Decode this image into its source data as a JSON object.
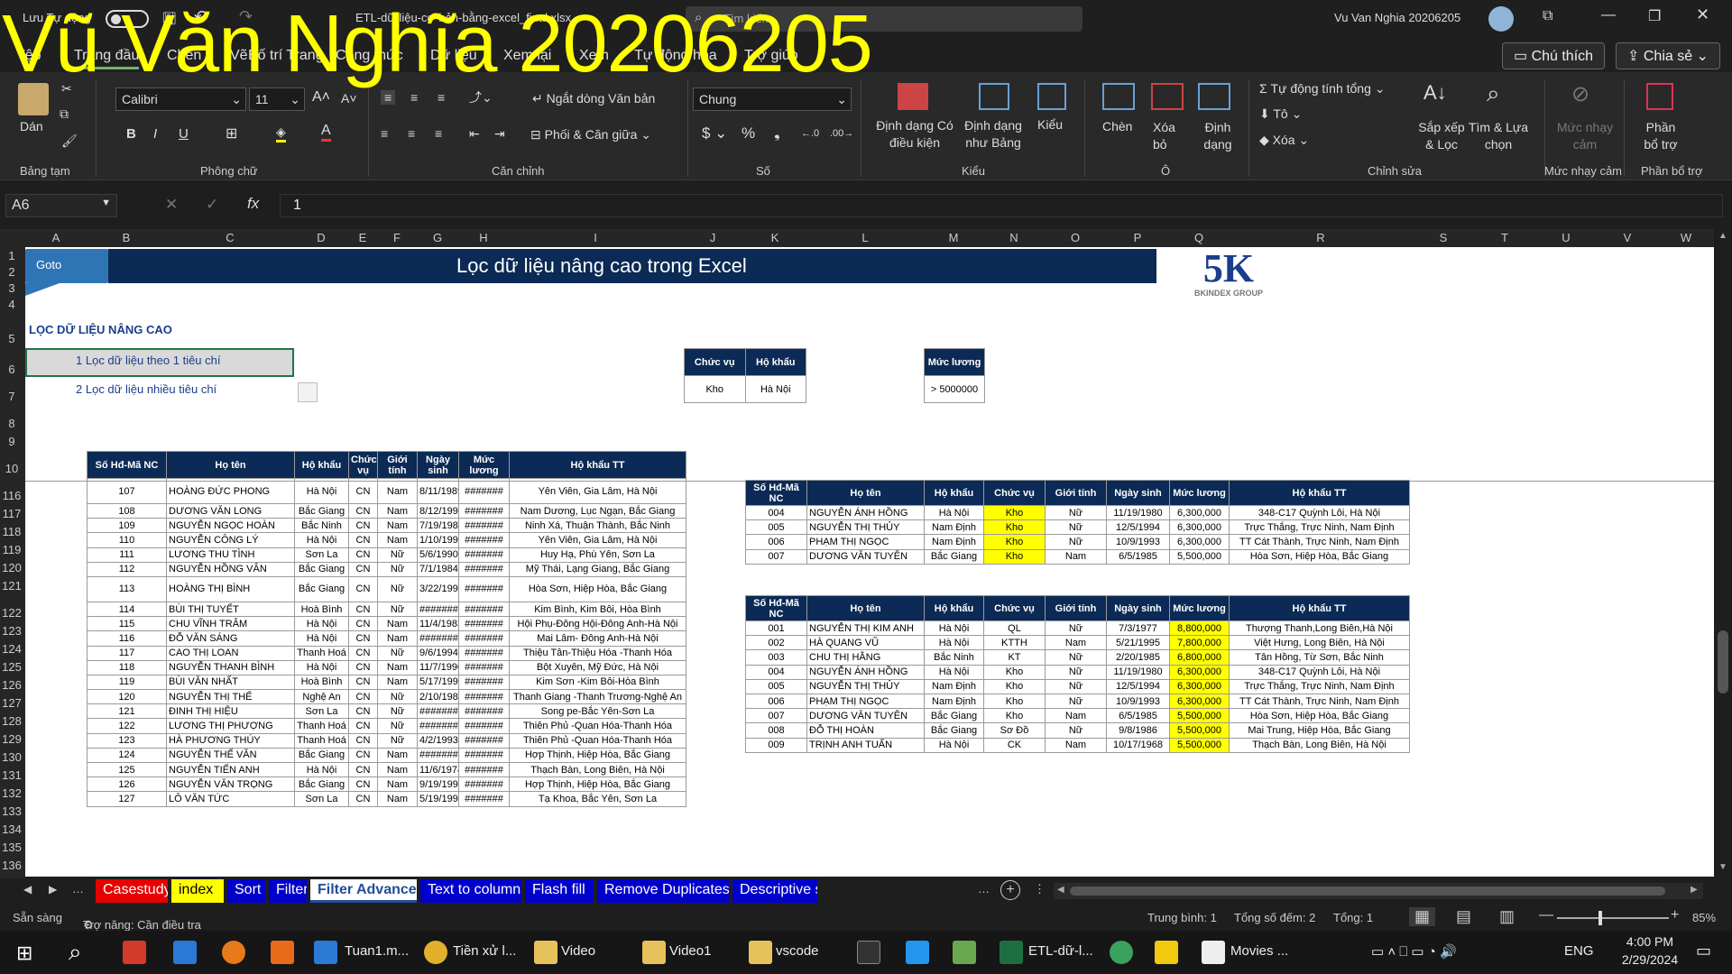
{
  "watermark": "Vũ Văn Nghĩa 20206205",
  "titlebar": {
    "autosave": "Lưu Tự động",
    "filename": "ETL-dữ-liệu-cơ-bản-bằng-excel_final.xlsx",
    "search": "Tìm kiếm",
    "user": "Vu Van Nghia 20206205"
  },
  "tabs": [
    "Tệp",
    "Trang đầu",
    "Chèn",
    "Vẽ",
    "Bố trí Trang",
    "Công thức",
    "Dữ liệu",
    "Xem lại",
    "Xem",
    "Tự động hóa",
    "Trợ giúp"
  ],
  "actions": {
    "comments": "Chú thích",
    "share": "Chia sẻ"
  },
  "ribbon": {
    "paste": "Dán",
    "font": "Calibri",
    "size": "11",
    "wrap": "Ngắt dòng Văn bản",
    "merge": "Phối & Căn giữa",
    "numfmt": "Chung",
    "cond": "Định dạng Có điều kiện",
    "table": "Định dạng như Bảng",
    "styles": "Kiểu",
    "insert": "Chèn",
    "delete": "Xóa bỏ",
    "format": "Định dạng",
    "autosum": "Tự động tính tổng",
    "fill": "Tô",
    "clear": "Xóa",
    "sort": "Sắp xếp & Lọc",
    "find": "Tìm & Lựa chọn",
    "sens": "Mức nhạy cảm",
    "addins": "Phần bổ trợ",
    "groups": [
      "Bảng tạm",
      "Phông chữ",
      "Căn chỉnh",
      "Số",
      "Kiểu",
      "Ô",
      "Chỉnh sửa",
      "Mức nhạy cảm",
      "Phần bổ trợ"
    ]
  },
  "formula": {
    "name": "A6",
    "value": "1"
  },
  "columns": [
    "A",
    "B",
    "C",
    "D",
    "E",
    "F",
    "G",
    "H",
    "I",
    "J",
    "K",
    "L",
    "M",
    "N",
    "O",
    "P",
    "Q",
    "R",
    "S",
    "T",
    "U",
    "V",
    "W"
  ],
  "rows": [
    "1",
    "2",
    "3",
    "4",
    "5",
    "6",
    "7",
    "8",
    "9",
    "10",
    "116",
    "117",
    "118",
    "119",
    "120",
    "121",
    "122",
    "123",
    "124",
    "125",
    "126",
    "127",
    "128",
    "129",
    "130",
    "131",
    "132",
    "133",
    "134",
    "135",
    "136"
  ],
  "sheet": {
    "goto": "Goto",
    "banner": "Lọc dữ liệu nâng cao trong Excel",
    "logo": "5K",
    "logo_sub": "BKINDEX GROUP",
    "section": "LỌC DỮ LIỆU NÂNG CAO",
    "items": [
      {
        "n": "1",
        "t": "Lọc dữ liệu theo 1 tiêu chí"
      },
      {
        "n": "2",
        "t": "Lọc dữ liệu nhiều tiêu chí"
      }
    ],
    "crit1": {
      "h": [
        "Chức vụ",
        "Hộ khẩu"
      ],
      "v": [
        "Kho",
        "Hà Nội"
      ]
    },
    "crit2": {
      "h": "Mức lương",
      "v": "> 5000000"
    },
    "main": {
      "headers": [
        "Số Hđ-Mã NC",
        "Họ tên",
        "Hộ khẩu",
        "Chức vụ",
        "Giới tính",
        "Ngày sinh",
        "Mức lương",
        "Hộ khẩu TT"
      ],
      "rows": [
        [
          "107",
          "HOÀNG ĐỨC PHONG",
          "Hà Nội",
          "CN",
          "Nam",
          "8/11/1989",
          "#######",
          "Yên Viên, Gia Lâm, Hà Nội"
        ],
        [
          "108",
          "DƯƠNG VĂN LONG",
          "Bắc Giang",
          "CN",
          "Nam",
          "8/12/1995",
          "#######",
          "Nam Dương, Lục Ngạn, Bắc Giang"
        ],
        [
          "109",
          "NGUYỄN NGỌC HOÀN",
          "Bắc Ninh",
          "CN",
          "Nam",
          "7/19/1987",
          "#######",
          "Ninh Xá, Thuận Thành, Bắc Ninh"
        ],
        [
          "110",
          "NGUYỄN CÔNG LÝ",
          "Hà Nội",
          "CN",
          "Nam",
          "1/10/1990",
          "#######",
          "Yên Viên, Gia Lâm, Hà Nội"
        ],
        [
          "111",
          "LƯƠNG THU TÌNH",
          "Sơn La",
          "CN",
          "Nữ",
          "5/6/1990",
          "#######",
          "Huy Hạ, Phù Yên, Sơn La"
        ],
        [
          "112",
          "NGUYỄN HỒNG VÂN",
          "Bắc Giang",
          "CN",
          "Nữ",
          "7/1/1984",
          "#######",
          "Mỹ Thái, Lạng Giang, Bắc Giang"
        ],
        [
          "113",
          "HOÀNG THỊ BÌNH",
          "Bắc Giang",
          "CN",
          "Nữ",
          "3/22/1991",
          "#######",
          "Hòa Sơn, Hiệp Hòa, Bắc Giang"
        ],
        [
          "114",
          "BÙI THỊ TUYẾT",
          "Hoà Bình",
          "CN",
          "Nữ",
          "#######",
          "#######",
          "Kim Bình, Kim Bôi, Hòa Bình"
        ],
        [
          "115",
          "CHU VĨNH TRÂM",
          "Hà Nội",
          "CN",
          "Nam",
          "11/4/1983",
          "#######",
          "Hội Phụ-Đông Hội-Đông Anh-Hà Nội"
        ],
        [
          "116",
          "ĐỖ VĂN SÁNG",
          "Hà Nội",
          "CN",
          "Nam",
          "#######",
          "#######",
          "Mai Lâm- Đông Anh-Hà Nội"
        ],
        [
          "117",
          "CAO THỊ LOAN",
          "Thanh Hoá",
          "CN",
          "Nữ",
          "9/6/1994",
          "#######",
          "Thiệu Tân-Thiệu Hóa -Thanh Hóa"
        ],
        [
          "118",
          "NGUYỄN THANH BÌNH",
          "Hà Nội",
          "CN",
          "Nam",
          "11/7/1990",
          "#######",
          "Bột Xuyên, Mỹ Đức, Hà Nội"
        ],
        [
          "119",
          "BÙI VĂN NHẤT",
          "Hoà Bình",
          "CN",
          "Nam",
          "5/17/1998",
          "#######",
          "Kim Sơn -Kim Bôi-Hòa Bình"
        ],
        [
          "120",
          "NGUYỄN THỊ THỂ",
          "Nghệ An",
          "CN",
          "Nữ",
          "2/10/1985",
          "#######",
          "Thanh Giang -Thanh Trương-Nghệ An"
        ],
        [
          "121",
          "ĐINH THỊ HIỆU",
          "Sơn La",
          "CN",
          "Nữ",
          "#######",
          "#######",
          "Song pe-Bắc Yên-Sơn La"
        ],
        [
          "122",
          "LƯƠNG THỊ PHƯỢNG",
          "Thanh Hoá",
          "CN",
          "Nữ",
          "#######",
          "#######",
          "Thiên Phủ -Quan Hóa-Thanh Hóa"
        ],
        [
          "123",
          "HÀ PHƯƠNG THÚY",
          "Thanh Hoá",
          "CN",
          "Nữ",
          "4/2/1993",
          "#######",
          "Thiên Phủ -Quan Hóa-Thanh Hóa"
        ],
        [
          "124",
          "NGUYỄN THẾ VĂN",
          "Bắc Giang",
          "CN",
          "Nam",
          "#######",
          "#######",
          "Hợp Thịnh, Hiệp Hòa, Bắc Giang"
        ],
        [
          "125",
          "NGUYỄN TIẾN ANH",
          "Hà Nội",
          "CN",
          "Nam",
          "11/6/1974",
          "#######",
          "Thạch Bàn, Long Biên, Hà Nội"
        ],
        [
          "126",
          "NGUYỄN VĂN TRỌNG",
          "Bắc Giang",
          "CN",
          "Nam",
          "9/19/1993",
          "#######",
          "Hợp Thịnh, Hiệp Hòa, Bắc Giang"
        ],
        [
          "127",
          "LÔ VĂN TỨC",
          "Sơn La",
          "CN",
          "Nam",
          "5/19/1994",
          "#######",
          "Tạ Khoa, Bắc Yên, Sơn La"
        ]
      ]
    },
    "r1": {
      "headers": [
        "Số Hđ-Mã NC",
        "Họ tên",
        "Hộ khẩu",
        "Chức vụ",
        "Giới tính",
        "Ngày sinh",
        "Mức lương",
        "Hộ khẩu TT"
      ],
      "rows": [
        [
          "004",
          "NGUYỄN ÁNH HỒNG",
          "Hà Nội",
          "Kho",
          "Nữ",
          "11/19/1980",
          "6,300,000",
          "348-C17 Quỳnh Lôi, Hà Nội"
        ],
        [
          "005",
          "NGUYỄN THỊ THỦY",
          "Nam Định",
          "Kho",
          "Nữ",
          "12/5/1994",
          "6,300,000",
          "Trực Thắng, Trực Ninh, Nam Định"
        ],
        [
          "006",
          "PHẠM THỊ NGỌC",
          "Nam Định",
          "Kho",
          "Nữ",
          "10/9/1993",
          "6,300,000",
          "TT Cát Thành, Trực Ninh, Nam Định"
        ],
        [
          "007",
          "DƯƠNG VĂN TUYÊN",
          "Bắc Giang",
          "Kho",
          "Nam",
          "6/5/1985",
          "5,500,000",
          "Hòa Sơn, Hiệp Hòa, Bắc Giang"
        ]
      ]
    },
    "r2": {
      "headers": [
        "Số Hđ-Mã NC",
        "Họ tên",
        "Hộ khẩu",
        "Chức vụ",
        "Giới tính",
        "Ngày sinh",
        "Mức lương",
        "Hộ khẩu TT"
      ],
      "rows": [
        [
          "001",
          "NGUYỄN THỊ KIM ANH",
          "Hà Nội",
          "QL",
          "Nữ",
          "7/3/1977",
          "8,800,000",
          "Thượng Thanh,Long Biên,Hà Nội"
        ],
        [
          "002",
          "HÀ QUANG VŨ",
          "Hà Nội",
          "KTTH",
          "Nam",
          "5/21/1995",
          "7,800,000",
          "Việt Hưng, Long Biên, Hà Nội"
        ],
        [
          "003",
          "CHU THỊ HẰNG",
          "Bắc Ninh",
          "KT",
          "Nữ",
          "2/20/1985",
          "6,800,000",
          "Tân Hồng, Từ Sơn, Bắc Ninh"
        ],
        [
          "004",
          "NGUYỄN ÁNH HỒNG",
          "Hà Nội",
          "Kho",
          "Nữ",
          "11/19/1980",
          "6,300,000",
          "348-C17 Quỳnh Lôi, Hà Nội"
        ],
        [
          "005",
          "NGUYỄN THỊ THỦY",
          "Nam Định",
          "Kho",
          "Nữ",
          "12/5/1994",
          "6,300,000",
          "Trực Thắng, Trực Ninh, Nam Định"
        ],
        [
          "006",
          "PHẠM THỊ NGỌC",
          "Nam Định",
          "Kho",
          "Nữ",
          "10/9/1993",
          "6,300,000",
          "TT Cát Thành, Trực Ninh, Nam Định"
        ],
        [
          "007",
          "DƯƠNG VĂN TUYÊN",
          "Bắc Giang",
          "Kho",
          "Nam",
          "6/5/1985",
          "5,500,000",
          "Hòa Sơn, Hiệp Hòa, Bắc Giang"
        ],
        [
          "008",
          "ĐỖ THỊ HOÀN",
          "Bắc Giang",
          "Sơ Đồ",
          "Nữ",
          "9/8/1986",
          "5,500,000",
          "Mai Trung, Hiệp Hòa, Bắc Giang"
        ],
        [
          "009",
          "TRỊNH ANH TUẤN",
          "Hà Nội",
          "CK",
          "Nam",
          "10/17/1968",
          "5,500,000",
          "Thạch Bàn, Long Biên, Hà Nội"
        ]
      ]
    }
  },
  "sheettabs": [
    {
      "t": "Casestudy",
      "c": "#e60000"
    },
    {
      "t": "index",
      "c": "#ffff00",
      "fg": "#000"
    },
    {
      "t": "Sort",
      "c": "#0000cc"
    },
    {
      "t": "Filter",
      "c": "#0000cc"
    },
    {
      "t": "Filter Advanced",
      "c": "#ffffff",
      "fg": "#1f4e9a",
      "active": true
    },
    {
      "t": "Text to columns",
      "c": "#0000cc"
    },
    {
      "t": "Flash fill",
      "c": "#0000cc"
    },
    {
      "t": "Remove Duplicates",
      "c": "#0000cc"
    },
    {
      "t": "Descriptive s",
      "c": "#0000cc"
    }
  ],
  "status": {
    "ready": "Sẵn sàng",
    "access": "Trợ năng: Cần điều tra",
    "avg": "Trung bình: 1",
    "count": "Tổng số đếm: 2",
    "sum": "Tổng: 1",
    "zoom": "85%"
  },
  "taskbar": {
    "items": [
      "Tuan1.m...",
      "Tiền xử l...",
      "Video",
      "Video1",
      "vscode",
      "ETL-dữ-l...",
      "Movies ..."
    ],
    "lang": "ENG",
    "time": "4:00 PM",
    "date": "2/29/2024"
  }
}
